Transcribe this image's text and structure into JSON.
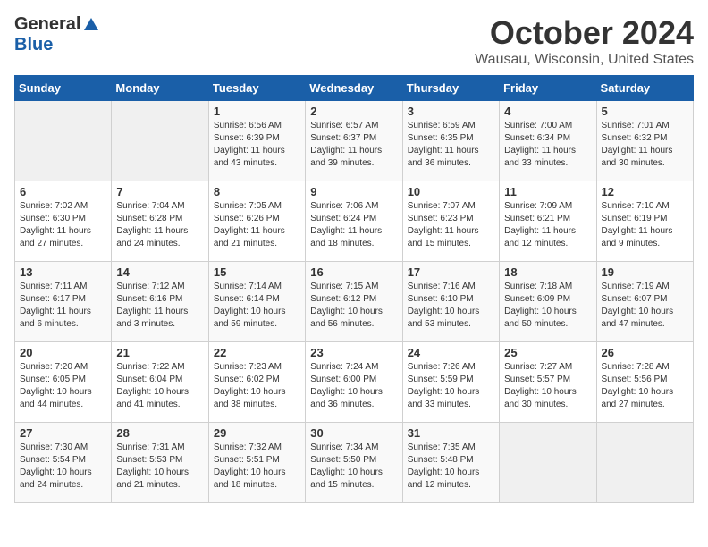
{
  "header": {
    "logo_general": "General",
    "logo_blue": "Blue",
    "month": "October 2024",
    "location": "Wausau, Wisconsin, United States"
  },
  "weekdays": [
    "Sunday",
    "Monday",
    "Tuesday",
    "Wednesday",
    "Thursday",
    "Friday",
    "Saturday"
  ],
  "weeks": [
    [
      {
        "day": "",
        "sunrise": "",
        "sunset": "",
        "daylight": "",
        "empty": true
      },
      {
        "day": "",
        "sunrise": "",
        "sunset": "",
        "daylight": "",
        "empty": true
      },
      {
        "day": "1",
        "sunrise": "Sunrise: 6:56 AM",
        "sunset": "Sunset: 6:39 PM",
        "daylight": "Daylight: 11 hours and 43 minutes."
      },
      {
        "day": "2",
        "sunrise": "Sunrise: 6:57 AM",
        "sunset": "Sunset: 6:37 PM",
        "daylight": "Daylight: 11 hours and 39 minutes."
      },
      {
        "day": "3",
        "sunrise": "Sunrise: 6:59 AM",
        "sunset": "Sunset: 6:35 PM",
        "daylight": "Daylight: 11 hours and 36 minutes."
      },
      {
        "day": "4",
        "sunrise": "Sunrise: 7:00 AM",
        "sunset": "Sunset: 6:34 PM",
        "daylight": "Daylight: 11 hours and 33 minutes."
      },
      {
        "day": "5",
        "sunrise": "Sunrise: 7:01 AM",
        "sunset": "Sunset: 6:32 PM",
        "daylight": "Daylight: 11 hours and 30 minutes."
      }
    ],
    [
      {
        "day": "6",
        "sunrise": "Sunrise: 7:02 AM",
        "sunset": "Sunset: 6:30 PM",
        "daylight": "Daylight: 11 hours and 27 minutes."
      },
      {
        "day": "7",
        "sunrise": "Sunrise: 7:04 AM",
        "sunset": "Sunset: 6:28 PM",
        "daylight": "Daylight: 11 hours and 24 minutes."
      },
      {
        "day": "8",
        "sunrise": "Sunrise: 7:05 AM",
        "sunset": "Sunset: 6:26 PM",
        "daylight": "Daylight: 11 hours and 21 minutes."
      },
      {
        "day": "9",
        "sunrise": "Sunrise: 7:06 AM",
        "sunset": "Sunset: 6:24 PM",
        "daylight": "Daylight: 11 hours and 18 minutes."
      },
      {
        "day": "10",
        "sunrise": "Sunrise: 7:07 AM",
        "sunset": "Sunset: 6:23 PM",
        "daylight": "Daylight: 11 hours and 15 minutes."
      },
      {
        "day": "11",
        "sunrise": "Sunrise: 7:09 AM",
        "sunset": "Sunset: 6:21 PM",
        "daylight": "Daylight: 11 hours and 12 minutes."
      },
      {
        "day": "12",
        "sunrise": "Sunrise: 7:10 AM",
        "sunset": "Sunset: 6:19 PM",
        "daylight": "Daylight: 11 hours and 9 minutes."
      }
    ],
    [
      {
        "day": "13",
        "sunrise": "Sunrise: 7:11 AM",
        "sunset": "Sunset: 6:17 PM",
        "daylight": "Daylight: 11 hours and 6 minutes."
      },
      {
        "day": "14",
        "sunrise": "Sunrise: 7:12 AM",
        "sunset": "Sunset: 6:16 PM",
        "daylight": "Daylight: 11 hours and 3 minutes."
      },
      {
        "day": "15",
        "sunrise": "Sunrise: 7:14 AM",
        "sunset": "Sunset: 6:14 PM",
        "daylight": "Daylight: 10 hours and 59 minutes."
      },
      {
        "day": "16",
        "sunrise": "Sunrise: 7:15 AM",
        "sunset": "Sunset: 6:12 PM",
        "daylight": "Daylight: 10 hours and 56 minutes."
      },
      {
        "day": "17",
        "sunrise": "Sunrise: 7:16 AM",
        "sunset": "Sunset: 6:10 PM",
        "daylight": "Daylight: 10 hours and 53 minutes."
      },
      {
        "day": "18",
        "sunrise": "Sunrise: 7:18 AM",
        "sunset": "Sunset: 6:09 PM",
        "daylight": "Daylight: 10 hours and 50 minutes."
      },
      {
        "day": "19",
        "sunrise": "Sunrise: 7:19 AM",
        "sunset": "Sunset: 6:07 PM",
        "daylight": "Daylight: 10 hours and 47 minutes."
      }
    ],
    [
      {
        "day": "20",
        "sunrise": "Sunrise: 7:20 AM",
        "sunset": "Sunset: 6:05 PM",
        "daylight": "Daylight: 10 hours and 44 minutes."
      },
      {
        "day": "21",
        "sunrise": "Sunrise: 7:22 AM",
        "sunset": "Sunset: 6:04 PM",
        "daylight": "Daylight: 10 hours and 41 minutes."
      },
      {
        "day": "22",
        "sunrise": "Sunrise: 7:23 AM",
        "sunset": "Sunset: 6:02 PM",
        "daylight": "Daylight: 10 hours and 38 minutes."
      },
      {
        "day": "23",
        "sunrise": "Sunrise: 7:24 AM",
        "sunset": "Sunset: 6:00 PM",
        "daylight": "Daylight: 10 hours and 36 minutes."
      },
      {
        "day": "24",
        "sunrise": "Sunrise: 7:26 AM",
        "sunset": "Sunset: 5:59 PM",
        "daylight": "Daylight: 10 hours and 33 minutes."
      },
      {
        "day": "25",
        "sunrise": "Sunrise: 7:27 AM",
        "sunset": "Sunset: 5:57 PM",
        "daylight": "Daylight: 10 hours and 30 minutes."
      },
      {
        "day": "26",
        "sunrise": "Sunrise: 7:28 AM",
        "sunset": "Sunset: 5:56 PM",
        "daylight": "Daylight: 10 hours and 27 minutes."
      }
    ],
    [
      {
        "day": "27",
        "sunrise": "Sunrise: 7:30 AM",
        "sunset": "Sunset: 5:54 PM",
        "daylight": "Daylight: 10 hours and 24 minutes."
      },
      {
        "day": "28",
        "sunrise": "Sunrise: 7:31 AM",
        "sunset": "Sunset: 5:53 PM",
        "daylight": "Daylight: 10 hours and 21 minutes."
      },
      {
        "day": "29",
        "sunrise": "Sunrise: 7:32 AM",
        "sunset": "Sunset: 5:51 PM",
        "daylight": "Daylight: 10 hours and 18 minutes."
      },
      {
        "day": "30",
        "sunrise": "Sunrise: 7:34 AM",
        "sunset": "Sunset: 5:50 PM",
        "daylight": "Daylight: 10 hours and 15 minutes."
      },
      {
        "day": "31",
        "sunrise": "Sunrise: 7:35 AM",
        "sunset": "Sunset: 5:48 PM",
        "daylight": "Daylight: 10 hours and 12 minutes."
      },
      {
        "day": "",
        "sunrise": "",
        "sunset": "",
        "daylight": "",
        "empty": true
      },
      {
        "day": "",
        "sunrise": "",
        "sunset": "",
        "daylight": "",
        "empty": true
      }
    ]
  ]
}
